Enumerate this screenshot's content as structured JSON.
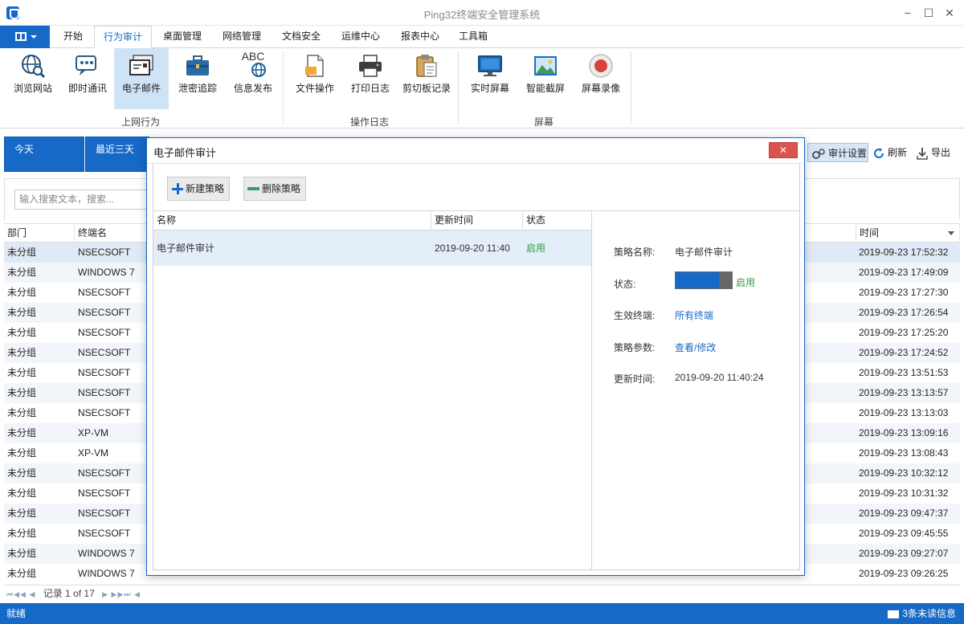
{
  "window": {
    "title": "Ping32终端安全管理系统",
    "minimize": "−",
    "maximize": "☐",
    "close": "✕"
  },
  "menu": {
    "tabs": [
      "开始",
      "行为审计",
      "桌面管理",
      "网络管理",
      "文档安全",
      "运维中心",
      "报表中心",
      "工具箱"
    ],
    "active": "行为审计"
  },
  "ribbon": {
    "buttons": [
      {
        "label": "浏览网站",
        "icon": "globe-search-icon"
      },
      {
        "label": "即时通讯",
        "icon": "chat-icon"
      },
      {
        "label": "电子邮件",
        "icon": "email-icon",
        "selected": true
      },
      {
        "label": "泄密追踪",
        "icon": "briefcase-icon"
      },
      {
        "label": "信息发布",
        "icon": "abc-globe-icon"
      },
      {
        "label": "文件操作",
        "icon": "document-icon"
      },
      {
        "label": "打印日志",
        "icon": "printer-icon"
      },
      {
        "label": "剪切板记录",
        "icon": "clipboard-icon"
      },
      {
        "label": "实时屏幕",
        "icon": "monitor-icon"
      },
      {
        "label": "智能截屏",
        "icon": "image-icon"
      },
      {
        "label": "屏幕录像",
        "icon": "record-icon"
      }
    ],
    "groups": [
      "上网行为",
      "操作日志",
      "屏幕"
    ],
    "abc_text": "ABC"
  },
  "filters": {
    "today": "今天",
    "last_three_days": "最近三天"
  },
  "toolbar": {
    "audit_settings": "审计设置",
    "refresh": "刷新",
    "export": "导出"
  },
  "search": {
    "placeholder": "输入搜索文本，搜索..."
  },
  "table": {
    "headers": {
      "dept": "部门",
      "terminal": "终端名",
      "time": "时间"
    },
    "rows": [
      {
        "dept": "未分组",
        "terminal": "NSECSOFT",
        "time": "2019-09-23 17:52:32"
      },
      {
        "dept": "未分组",
        "terminal": "WINDOWS 7",
        "time": "2019-09-23 17:49:09"
      },
      {
        "dept": "未分组",
        "terminal": "NSECSOFT",
        "time": "2019-09-23 17:27:30"
      },
      {
        "dept": "未分组",
        "terminal": "NSECSOFT",
        "time": "2019-09-23 17:26:54"
      },
      {
        "dept": "未分组",
        "terminal": "NSECSOFT",
        "time": "2019-09-23 17:25:20"
      },
      {
        "dept": "未分组",
        "terminal": "NSECSOFT",
        "time": "2019-09-23 17:24:52"
      },
      {
        "dept": "未分组",
        "terminal": "NSECSOFT",
        "time": "2019-09-23 13:51:53"
      },
      {
        "dept": "未分组",
        "terminal": "NSECSOFT",
        "time": "2019-09-23 13:13:57"
      },
      {
        "dept": "未分组",
        "terminal": "NSECSOFT",
        "time": "2019-09-23 13:13:03"
      },
      {
        "dept": "未分组",
        "terminal": "XP-VM",
        "time": "2019-09-23 13:09:16"
      },
      {
        "dept": "未分组",
        "terminal": "XP-VM",
        "time": "2019-09-23 13:08:43"
      },
      {
        "dept": "未分组",
        "terminal": "NSECSOFT",
        "time": "2019-09-23 10:32:12"
      },
      {
        "dept": "未分组",
        "terminal": "NSECSOFT",
        "time": "2019-09-23 10:31:32"
      },
      {
        "dept": "未分组",
        "terminal": "NSECSOFT",
        "time": "2019-09-23 09:47:37"
      },
      {
        "dept": "未分组",
        "terminal": "NSECSOFT",
        "time": "2019-09-23 09:45:55"
      },
      {
        "dept": "未分组",
        "terminal": "WINDOWS 7",
        "time": "2019-09-23 09:27:07"
      },
      {
        "dept": "未分组",
        "terminal": "WINDOWS 7",
        "time": "2019-09-23 09:26:25"
      }
    ]
  },
  "pager": {
    "record_text": "记录 1 of 17"
  },
  "status": {
    "left": "就绪",
    "unread": "3条未读信息"
  },
  "dialog": {
    "title": "电子邮件审计",
    "close_label": "✕",
    "new_policy": "新建策略",
    "delete_policy": "删除策略",
    "columns": {
      "name": "名称",
      "updated": "更新时间",
      "status": "状态"
    },
    "policy": {
      "name": "电子邮件审计",
      "updated": "2019-09-20 11:40",
      "status": "启用"
    },
    "details": {
      "name_label": "策略名称:",
      "name_value": "电子邮件审计",
      "status_label": "状态:",
      "status_value": "启用",
      "terminals_label": "生效终端:",
      "terminals_value": "所有终端",
      "params_label": "策略参数:",
      "params_value": "查看/修改",
      "updated_label": "更新时间:",
      "updated_value": "2019-09-20 11:40:24"
    }
  },
  "colors": {
    "accent": "#1769c7",
    "enabled": "#2e9a3f",
    "close": "#d9534f"
  }
}
